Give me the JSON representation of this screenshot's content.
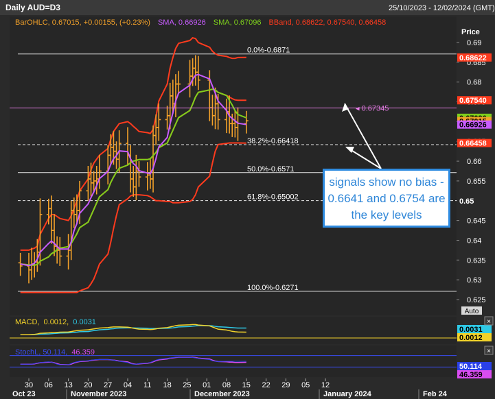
{
  "window": {
    "title": "Daily AUD=D3",
    "date_range": "25/10/2023 - 12/02/2024 (GMT)",
    "close_icon": "close-icon"
  },
  "legend": {
    "bar_label": "BarOHLC, 0.67015, +0.00155, (+0.23%)",
    "sma1_label": "SMA, 0.66926",
    "sma2_label": "SMA, 0.67096",
    "bband_label": "BBand, 0.68622, 0.67540, 0.66458"
  },
  "price_axis": {
    "title": "Price",
    "auto_button": "Auto",
    "ticks": [
      "0.69",
      "0.685",
      "0.68",
      "0.675",
      "0.67",
      "0.665",
      "0.66",
      "0.655",
      "0.65",
      "0.645",
      "0.64",
      "0.635",
      "0.63",
      "0.625"
    ]
  },
  "price_tags": [
    {
      "value": "0.68622",
      "bg": "#ff3b1e",
      "fg": "#ffffff"
    },
    {
      "value": "0.67540",
      "bg": "#ff3b1e",
      "fg": "#ffffff"
    },
    {
      "value": "0.67096",
      "bg": "#7ecf1c",
      "fg": "#000000"
    },
    {
      "value": "0.67015",
      "bg": "#f2a12a",
      "fg": "#000000"
    },
    {
      "value": "0.66926",
      "bg": "#c85cff",
      "fg": "#000000"
    },
    {
      "value": "0.66458",
      "bg": "#ff3b1e",
      "fg": "#ffffff"
    },
    {
      "value": "0.65",
      "bg": "#2a2a2a",
      "fg": "#ffffff"
    }
  ],
  "fib_levels": [
    {
      "label": "0.0%-0.6871",
      "price": 0.6871
    },
    {
      "label": "38.2%-0.66418",
      "price": 0.66418
    },
    {
      "label": "50.0%-0.6571",
      "price": 0.6571
    },
    {
      "label": "61.8%-0.65002",
      "price": 0.65002
    },
    {
      "label": "100.0%-0.6271",
      "price": 0.6271
    }
  ],
  "resistance_line": {
    "label": "0.67345",
    "price": 0.67345
  },
  "annotation": "signals show no bias - 0.6641 and 0.6754 are the key levels",
  "macd": {
    "label_name": "MACD,",
    "label_v1": "0.0012,",
    "label_v2": "0.0031",
    "tags": [
      {
        "value": "0.0031",
        "bg": "#2fc9e6",
        "fg": "#000000"
      },
      {
        "value": "0.0012",
        "bg": "#f2d22a",
        "fg": "#000000"
      }
    ]
  },
  "stoch": {
    "label_name": "StochL, 50.114,",
    "label_v2": "46.359",
    "tags": [
      {
        "value": "50.114",
        "bg": "#2a40e8",
        "fg": "#ffffff"
      },
      {
        "value": "46.359",
        "bg": "#d94cf0",
        "fg": "#000000"
      }
    ]
  },
  "x_axis": {
    "day_ticks": [
      "30",
      "06",
      "13",
      "20",
      "27",
      "04",
      "11",
      "18",
      "25",
      "01",
      "08",
      "15",
      "22",
      "29",
      "05",
      "12"
    ],
    "month_labels": [
      "Oct 23",
      "November 2023",
      "December 2023",
      "January 2024",
      "Feb 24"
    ]
  },
  "colors": {
    "bars": "#f2a12a",
    "sma_fast": "#c85cff",
    "sma_slow": "#7ecf1c",
    "bband": "#ff3b1e",
    "macd": "#f2d22a",
    "signal": "#2fc9e6",
    "stoch_k": "#2a40e8",
    "stoch_d": "#d94cf0",
    "annotation": "#2e86d8"
  },
  "chart_data": {
    "type": "line",
    "title": "Daily AUD=D3",
    "ylabel": "Price",
    "ylim": [
      0.6235,
      0.6925
    ],
    "x": [
      "2023-10-27",
      "2023-10-30",
      "2023-10-31",
      "2023-11-01",
      "2023-11-02",
      "2023-11-03",
      "2023-11-06",
      "2023-11-07",
      "2023-11-08",
      "2023-11-09",
      "2023-11-10",
      "2023-11-13",
      "2023-11-14",
      "2023-11-15",
      "2023-11-16",
      "2023-11-17",
      "2023-11-20",
      "2023-11-21",
      "2023-11-22",
      "2023-11-23",
      "2023-11-24",
      "2023-11-27",
      "2023-11-28",
      "2023-11-29",
      "2023-11-30",
      "2023-12-01",
      "2023-12-04",
      "2023-12-05",
      "2023-12-06",
      "2023-12-07",
      "2023-12-08",
      "2023-12-11",
      "2023-12-12",
      "2023-12-13",
      "2023-12-14",
      "2023-12-15",
      "2023-12-18",
      "2023-12-19",
      "2023-12-20",
      "2023-12-21",
      "2023-12-22",
      "2023-12-26",
      "2023-12-27",
      "2023-12-28",
      "2023-12-29",
      "2024-01-02",
      "2024-01-03",
      "2024-01-04",
      "2024-01-05",
      "2024-01-08",
      "2024-01-09",
      "2024-01-10",
      "2024-01-11",
      "2024-01-12",
      "2024-01-15"
    ],
    "series": [
      {
        "name": "BarOHLC",
        "values": [
          0.6335,
          0.6325,
          0.634,
          0.6345,
          0.637,
          0.6465,
          0.648,
          0.6425,
          0.6385,
          0.6375,
          0.636,
          0.6375,
          0.6475,
          0.6465,
          0.6475,
          0.6525,
          0.6555,
          0.6545,
          0.655,
          0.6555,
          0.6575,
          0.6615,
          0.6635,
          0.6625,
          0.6605,
          0.6645,
          0.6615,
          0.6555,
          0.6535,
          0.6575,
          0.656,
          0.6565,
          0.6555,
          0.6665,
          0.6685,
          0.6705,
          0.6715,
          0.6765,
          0.6745,
          0.6795,
          0.6795,
          0.6815,
          0.6835,
          0.6825,
          0.6805,
          0.6735,
          0.6715,
          0.6745,
          0.6705,
          0.6725,
          0.6695,
          0.6695,
          0.6685,
          0.6695,
          0.6702
        ]
      },
      {
        "name": "SMA, 0.66926",
        "values": [
          0.634,
          0.6336,
          0.6338,
          0.6342,
          0.6352,
          0.637,
          0.6392,
          0.6398,
          0.6392,
          0.6385,
          0.6378,
          0.6378,
          0.6396,
          0.6424,
          0.6442,
          0.6468,
          0.6492,
          0.6508,
          0.6522,
          0.6538,
          0.6556,
          0.6574,
          0.6592,
          0.6606,
          0.6614,
          0.6626,
          0.6624,
          0.6606,
          0.6594,
          0.6588,
          0.6576,
          0.657,
          0.6568,
          0.6582,
          0.6606,
          0.6636,
          0.666,
          0.6694,
          0.6722,
          0.6752,
          0.6772,
          0.6792,
          0.6807,
          0.6817,
          0.6819,
          0.6808,
          0.679,
          0.6772,
          0.6752,
          0.6728,
          0.6714,
          0.6708,
          0.6702,
          0.6696,
          0.66926
        ]
      },
      {
        "name": "SMA, 0.67096",
        "values": [
          0.634,
          0.6338,
          0.6337,
          0.6337,
          0.6339,
          0.6347,
          0.6358,
          0.6366,
          0.637,
          0.6376,
          0.638,
          0.6384,
          0.6392,
          0.6404,
          0.6416,
          0.6432,
          0.6446,
          0.6462,
          0.6478,
          0.6494,
          0.651,
          0.6528,
          0.6546,
          0.656,
          0.6572,
          0.6582,
          0.659,
          0.6596,
          0.66,
          0.6602,
          0.6604,
          0.6604,
          0.6606,
          0.6614,
          0.6622,
          0.6634,
          0.6646,
          0.6662,
          0.6678,
          0.6694,
          0.671,
          0.6728,
          0.6744,
          0.6762,
          0.6774,
          0.678,
          0.6782,
          0.678,
          0.6774,
          0.6766,
          0.6754,
          0.6742,
          0.6728,
          0.6718,
          0.67096
        ]
      },
      {
        "name": "BBand, 0.68622",
        "values": [
          0.6375,
          0.6375,
          0.6378,
          0.638,
          0.6385,
          0.6415,
          0.6455,
          0.6465,
          0.6465,
          0.646,
          0.6455,
          0.645,
          0.6462,
          0.648,
          0.65,
          0.6525,
          0.6555,
          0.6578,
          0.6595,
          0.6605,
          0.6615,
          0.6632,
          0.6655,
          0.6675,
          0.6685,
          0.6695,
          0.67,
          0.6695,
          0.6688,
          0.6682,
          0.6675,
          0.6672,
          0.667,
          0.668,
          0.6712,
          0.6752,
          0.6795,
          0.6835,
          0.6862,
          0.6885,
          0.6898,
          0.6905,
          0.6912,
          0.691,
          0.69,
          0.6888,
          0.6878,
          0.6872,
          0.6868,
          0.6865,
          0.6862,
          0.686,
          0.686,
          0.6862,
          0.68622
        ]
      },
      {
        "name": "BBand, 0.67540",
        "values": [
          0.634,
          0.6338,
          0.6337,
          0.6337,
          0.6339,
          0.6347,
          0.6358,
          0.6366,
          0.637,
          0.6376,
          0.638,
          0.6384,
          0.6392,
          0.6404,
          0.6416,
          0.6432,
          0.6446,
          0.6462,
          0.6478,
          0.6494,
          0.651,
          0.6528,
          0.6546,
          0.656,
          0.6572,
          0.6582,
          0.659,
          0.6596,
          0.66,
          0.6602,
          0.6604,
          0.6604,
          0.6606,
          0.6614,
          0.6622,
          0.6634,
          0.6646,
          0.6662,
          0.6678,
          0.6694,
          0.671,
          0.6728,
          0.6744,
          0.6762,
          0.6774,
          0.678,
          0.6782,
          0.678,
          0.6774,
          0.6766,
          0.6762,
          0.6758,
          0.6755,
          0.6754,
          0.6754
        ]
      },
      {
        "name": "BBand, 0.66458",
        "values": [
          0.6268,
          0.6268,
          0.6268,
          0.6268,
          0.6268,
          0.6268,
          0.6268,
          0.6268,
          0.6268,
          0.6268,
          0.6268,
          0.6268,
          0.6268,
          0.6268,
          0.6268,
          0.6272,
          0.628,
          0.629,
          0.6302,
          0.632,
          0.634,
          0.6365,
          0.6395,
          0.643,
          0.6462,
          0.649,
          0.6505,
          0.6512,
          0.6515,
          0.6515,
          0.6515,
          0.6513,
          0.651,
          0.6505,
          0.65,
          0.65,
          0.6498,
          0.6498,
          0.6495,
          0.6495,
          0.6495,
          0.6498,
          0.6503,
          0.6515,
          0.6535,
          0.6562,
          0.6595,
          0.6625,
          0.6642,
          0.6645,
          0.6646,
          0.6646,
          0.6646,
          0.6646,
          0.66458
        ]
      }
    ],
    "macd": {
      "ylim": [
        -0.004,
        0.008
      ],
      "macd": [
        0.0,
        0.0,
        0.0001,
        0.0002,
        0.0004,
        0.0007,
        0.0009,
        0.001,
        0.001,
        0.0011,
        0.0012,
        0.0013,
        0.0015,
        0.0017,
        0.0019,
        0.0021,
        0.0023,
        0.0025,
        0.0027,
        0.0029,
        0.0031,
        0.0033,
        0.0035,
        0.0036,
        0.0036,
        0.0036,
        0.0035,
        0.0033,
        0.003,
        0.0028,
        0.0026,
        0.0025,
        0.0024,
        0.0025,
        0.0027,
        0.003,
        0.0033,
        0.0036,
        0.0039,
        0.0042,
        0.0044,
        0.0046,
        0.0047,
        0.0047,
        0.0045,
        0.0041,
        0.0036,
        0.0031,
        0.0026,
        0.0022,
        0.0019,
        0.0016,
        0.0014,
        0.0013,
        0.0012
      ],
      "signal": [
        0.0,
        0.0,
        0.0,
        0.0001,
        0.0002,
        0.0003,
        0.0004,
        0.0005,
        0.0006,
        0.0007,
        0.0008,
        0.0009,
        0.001,
        0.0011,
        0.0012,
        0.0014,
        0.0015,
        0.0017,
        0.0019,
        0.0021,
        0.0023,
        0.0025,
        0.0027,
        0.0028,
        0.003,
        0.0031,
        0.0032,
        0.0032,
        0.0032,
        0.0031,
        0.0031,
        0.003,
        0.0029,
        0.0029,
        0.0029,
        0.0029,
        0.003,
        0.0031,
        0.0032,
        0.0034,
        0.0036,
        0.0038,
        0.004,
        0.0041,
        0.0042,
        0.0042,
        0.0041,
        0.0039,
        0.0037,
        0.0035,
        0.0034,
        0.0033,
        0.0032,
        0.0031,
        0.0031
      ]
    },
    "stoch": {
      "ylim": [
        0,
        100
      ],
      "k": [
        40,
        40,
        40,
        42,
        44,
        46,
        48,
        47,
        44,
        40,
        38,
        38,
        42,
        46,
        48,
        50,
        52,
        54,
        55,
        56,
        56,
        56,
        55,
        54,
        52,
        50,
        46,
        42,
        40,
        40,
        42,
        44,
        46,
        50,
        54,
        57,
        60,
        62,
        63,
        64,
        64,
        64,
        63,
        62,
        60,
        56,
        52,
        50,
        49,
        50,
        50,
        50,
        50,
        50,
        50.114
      ],
      "d": [
        40,
        40,
        40,
        41,
        43,
        45,
        47,
        47,
        45,
        42,
        39,
        38,
        40,
        44,
        47,
        49,
        51,
        53,
        54,
        55,
        56,
        56,
        55,
        54,
        53,
        51,
        48,
        44,
        41,
        40,
        41,
        43,
        45,
        48,
        52,
        55,
        58,
        61,
        62,
        63,
        64,
        64,
        64,
        63,
        61,
        58,
        54,
        51,
        49,
        48,
        47,
        47,
        46,
        46,
        46.359
      ]
    }
  }
}
